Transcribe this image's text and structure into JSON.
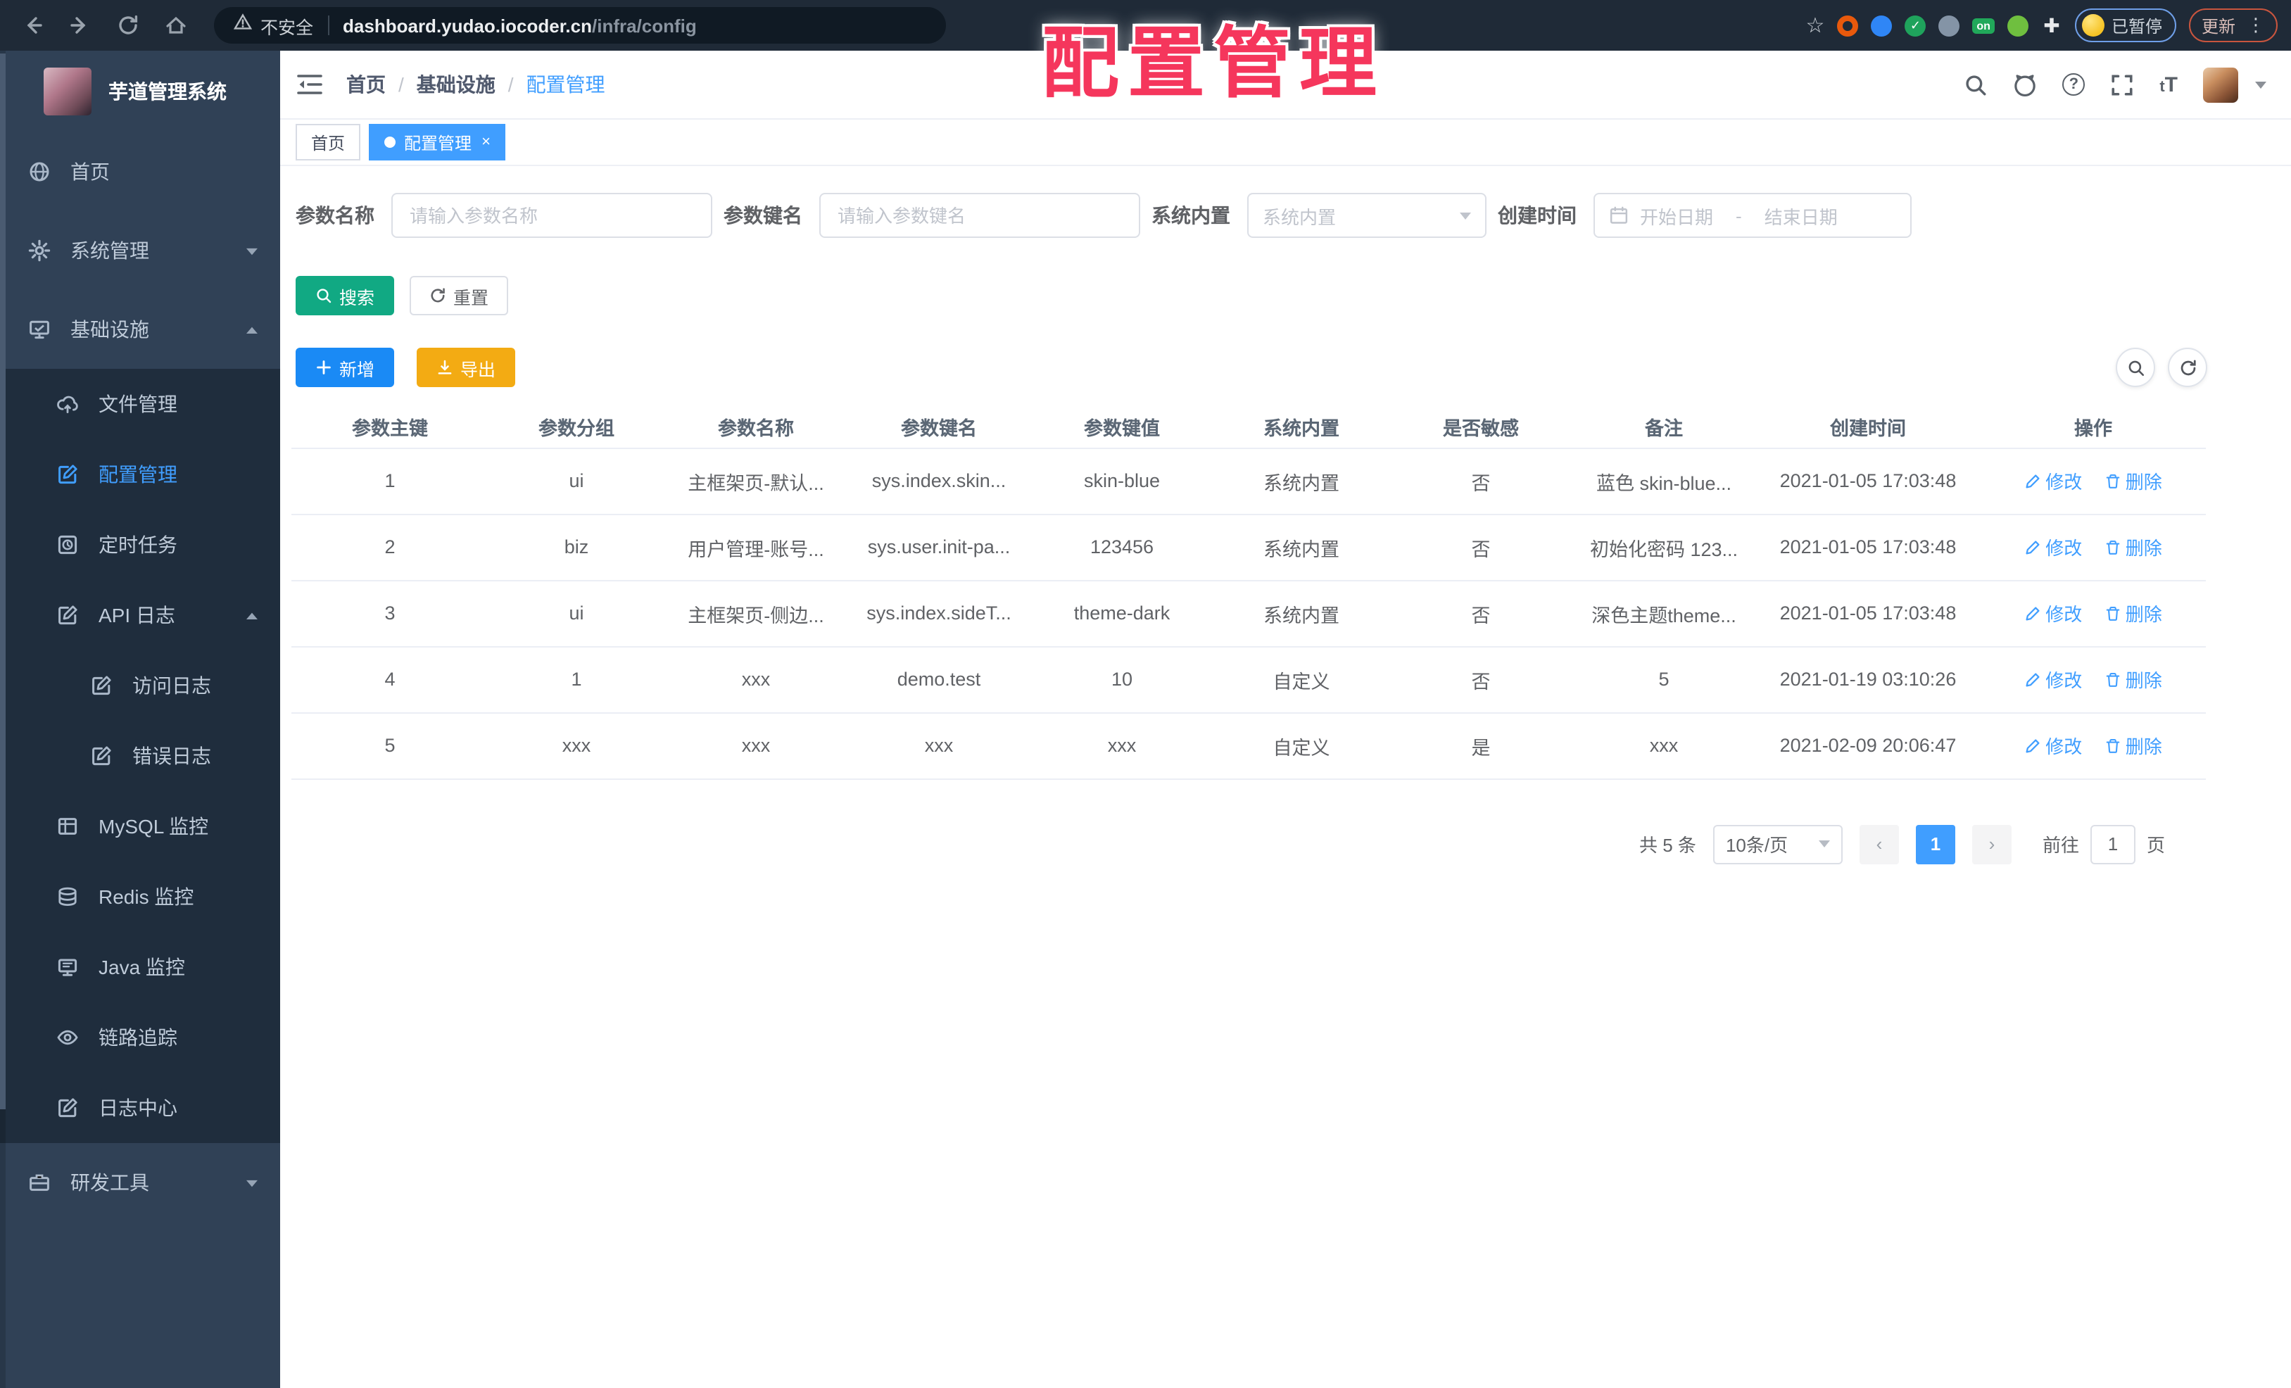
{
  "browser": {
    "security_label": "不安全",
    "url_host": "dashboard.yudao.iocoder.cn",
    "url_path": "/infra/config",
    "on_badge": "on",
    "check_glyph": "✓",
    "paused_badge": "已暂停",
    "update_button": "更新",
    "star_glyph": "☆",
    "kebab_glyph": "⋮"
  },
  "watermark": "配置管理",
  "colors": {
    "accent": "#409eff",
    "search_button": "#11a983",
    "add_button": "#1a8af5",
    "export_button": "#f3ab13",
    "watermark_red": "#f5365c",
    "sidebar_bg": "#304156",
    "submenu_bg": "#1f2d3d"
  },
  "sidebar": {
    "title": "芋道管理系统",
    "items": [
      {
        "label": "首页"
      },
      {
        "label": "系统管理"
      },
      {
        "label": "基础设施"
      },
      {
        "label": "研发工具"
      }
    ],
    "submenu": [
      {
        "label": "文件管理"
      },
      {
        "label": "配置管理"
      },
      {
        "label": "定时任务"
      },
      {
        "label": "API 日志"
      },
      {
        "label": "访问日志"
      },
      {
        "label": "错误日志"
      },
      {
        "label": "MySQL 监控"
      },
      {
        "label": "Redis 监控"
      },
      {
        "label": "Java 监控"
      },
      {
        "label": "链路追踪"
      },
      {
        "label": "日志中心"
      }
    ]
  },
  "header": {
    "breadcrumb": {
      "home": "首页",
      "section": "基础设施",
      "current": "配置管理"
    },
    "font_size_glyph_small": "t",
    "font_size_glyph_big": "T"
  },
  "tabs": [
    {
      "label": "首页"
    },
    {
      "label": "配置管理",
      "close": "×"
    }
  ],
  "filters": {
    "name": {
      "label": "参数名称",
      "placeholder": "请输入参数名称"
    },
    "key": {
      "label": "参数键名",
      "placeholder": "请输入参数键名"
    },
    "builtin": {
      "label": "系统内置",
      "placeholder": "系统内置"
    },
    "time": {
      "label": "创建时间",
      "start": "开始日期",
      "separator": "-",
      "end": "结束日期"
    }
  },
  "toolbar": {
    "search": "搜索",
    "reset": "重置",
    "add": "新增",
    "export": "导出"
  },
  "table": {
    "columns": [
      "参数主键",
      "参数分组",
      "参数名称",
      "参数键名",
      "参数键值",
      "系统内置",
      "是否敏感",
      "备注",
      "创建时间",
      "操作"
    ],
    "rows": [
      {
        "id": "1",
        "group": "ui",
        "name": "主框架页-默认...",
        "key": "sys.index.skin...",
        "value": "skin-blue",
        "builtin": "系统内置",
        "sensitive": "否",
        "remark": "蓝色 skin-blue...",
        "created": "2021-01-05 17:03:48"
      },
      {
        "id": "2",
        "group": "biz",
        "name": "用户管理-账号...",
        "key": "sys.user.init-pa...",
        "value": "123456",
        "builtin": "系统内置",
        "sensitive": "否",
        "remark": "初始化密码 123...",
        "created": "2021-01-05 17:03:48"
      },
      {
        "id": "3",
        "group": "ui",
        "name": "主框架页-侧边...",
        "key": "sys.index.sideT...",
        "value": "theme-dark",
        "builtin": "系统内置",
        "sensitive": "否",
        "remark": "深色主题theme...",
        "created": "2021-01-05 17:03:48"
      },
      {
        "id": "4",
        "group": "1",
        "name": "xxx",
        "key": "demo.test",
        "value": "10",
        "builtin": "自定义",
        "sensitive": "否",
        "remark": "5",
        "created": "2021-01-19 03:10:26"
      },
      {
        "id": "5",
        "group": "xxx",
        "name": "xxx",
        "key": "xxx",
        "value": "xxx",
        "builtin": "自定义",
        "sensitive": "是",
        "remark": "xxx",
        "created": "2021-02-09 20:06:47"
      }
    ],
    "edit_label": "修改",
    "delete_label": "删除"
  },
  "pagination": {
    "total": "共 5 条",
    "page_size": "10条/页",
    "prev": "‹",
    "current": "1",
    "next": "›",
    "goto_label": "前往",
    "goto_value": "1",
    "page_label": "页"
  }
}
